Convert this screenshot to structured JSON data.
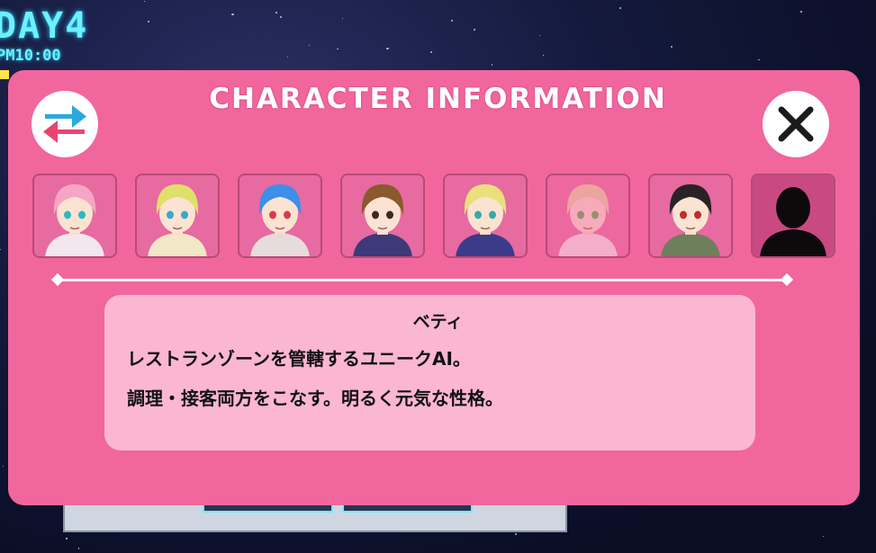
{
  "hud": {
    "day": "DAY4",
    "time": "PM10:00"
  },
  "dialog": {
    "title": "CHARACTER INFORMATION",
    "swap_icon": "swap-arrows-icon",
    "close_icon": "close-x-icon"
  },
  "characters": [
    {
      "icon": "pink-hair-girl",
      "locked": false,
      "hair": "#f6a6c4",
      "eyes": "#2fb7c2",
      "shirt": "#f3e7ee"
    },
    {
      "icon": "blonde-green-hair-girl",
      "locked": false,
      "hair": "#dfe06a",
      "eyes": "#3aa8c9",
      "shirt": "#f2e8c7"
    },
    {
      "icon": "blue-hair-girl",
      "locked": false,
      "hair": "#3d8fe8",
      "eyes": "#d63c50",
      "shirt": "#e7dcdc"
    },
    {
      "icon": "brown-hair-boy",
      "locked": false,
      "hair": "#8a5a2e",
      "eyes": "#3b2b20",
      "shirt": "#3d3a7a"
    },
    {
      "icon": "blonde-braid-girl",
      "locked": false,
      "hair": "#e7e07b",
      "eyes": "#3aa8a6",
      "shirt": "#3c3b8a"
    },
    {
      "icon": "blonde-boy-faded",
      "locked": false,
      "hair": "#e6d9a2",
      "eyes": "#4fb04f",
      "shirt": "#f4e9ee",
      "faded": true
    },
    {
      "icon": "black-bob-girl",
      "locked": false,
      "hair": "#2a2226",
      "eyes": "#c02d2d",
      "shirt": "#6d7f5d"
    },
    {
      "icon": "locked-silhouette",
      "locked": true
    }
  ],
  "selected": {
    "name": "ベティ",
    "line1": "レストランゾーンを管轄するユニークAI。",
    "line2": "調理・接客両方をこなす。明るく元気な性格。"
  },
  "colors": {
    "panel": "#f1669d",
    "info_box": "#fbb6d2",
    "hud_cyan": "#6cf0ff",
    "swap_blue": "#29a9e0",
    "swap_red": "#e8456e"
  }
}
